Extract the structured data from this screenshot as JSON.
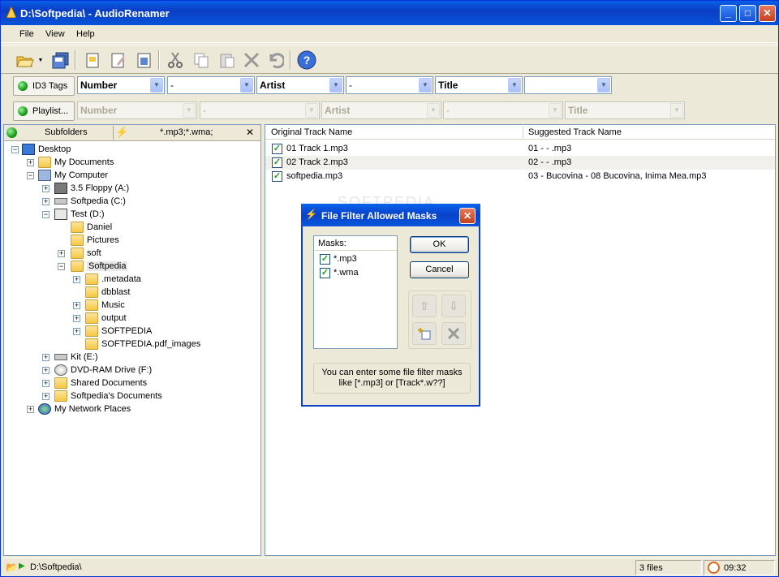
{
  "window": {
    "title": "D:\\Softpedia\\ - AudioRenamer"
  },
  "menu": {
    "items": [
      "File",
      "View",
      "Help"
    ]
  },
  "toolbar": {
    "icons": [
      "open-folder-icon",
      "dropdown-arrow-icon",
      "save-all-icon",
      "copy-name-icon",
      "edit-name-icon",
      "save-icon",
      "cut-icon",
      "copy-icon",
      "paste-icon",
      "delete-icon",
      "undo-icon",
      "help-icon"
    ]
  },
  "id3row": {
    "button_label": "ID3 Tags",
    "fields": [
      "Number",
      "-",
      "Artist",
      "-",
      "Title",
      ""
    ]
  },
  "playlistrow": {
    "button_label": "Playlist...",
    "fields": [
      "Number",
      "-",
      "Artist",
      "-",
      "Title"
    ]
  },
  "lefttabs": {
    "subfolders": "Subfolders",
    "filter": "*.mp3;*.wma;"
  },
  "tree": {
    "desktop": "Desktop",
    "mydocs": "My Documents",
    "mycomputer": "My Computer",
    "floppy": "3.5 Floppy (A:)",
    "c": "Softpedia (C:)",
    "d": "Test (D:)",
    "daniel": "Daniel",
    "pictures": "Pictures",
    "soft": "soft",
    "softpedia": "Softpedia",
    "metadata": ".metadata",
    "dbblast": "dbblast",
    "music": "Music",
    "output": "output",
    "SOFTPEDIA": "SOFTPEDIA",
    "pdfimages": "SOFTPEDIA.pdf_images",
    "kit": "Kit (E:)",
    "dvd": "DVD-RAM Drive (F:)",
    "shared": "Shared Documents",
    "spdocs": "Softpedia's Documents",
    "network": "My Network Places"
  },
  "tracklist": {
    "col_original": "Original Track Name",
    "col_suggested": "Suggested Track Name",
    "rows": [
      {
        "original": "01 Track 1.mp3",
        "suggested": "01 -  - .mp3"
      },
      {
        "original": "02 Track 2.mp3",
        "suggested": "02 -  - .mp3"
      },
      {
        "original": "softpedia.mp3",
        "suggested": "03 - Bucovina - 08 Bucovina, Inima Mea.mp3"
      }
    ]
  },
  "dialog": {
    "title": "File Filter Allowed Masks",
    "list_header": "Masks:",
    "masks": [
      "*.mp3",
      "*.wma"
    ],
    "ok": "OK",
    "cancel": "Cancel",
    "info": "You can enter some file filter masks like [*.mp3] or [Track*.w??]"
  },
  "watermark": "SOFTPEDIA",
  "status": {
    "path": "D:\\Softpedia\\",
    "files": "3 files",
    "time": "09:32"
  },
  "colors": {
    "titlebar": "#0a3ec4",
    "accent_green": "#15a015",
    "face": "#ece9d8"
  }
}
